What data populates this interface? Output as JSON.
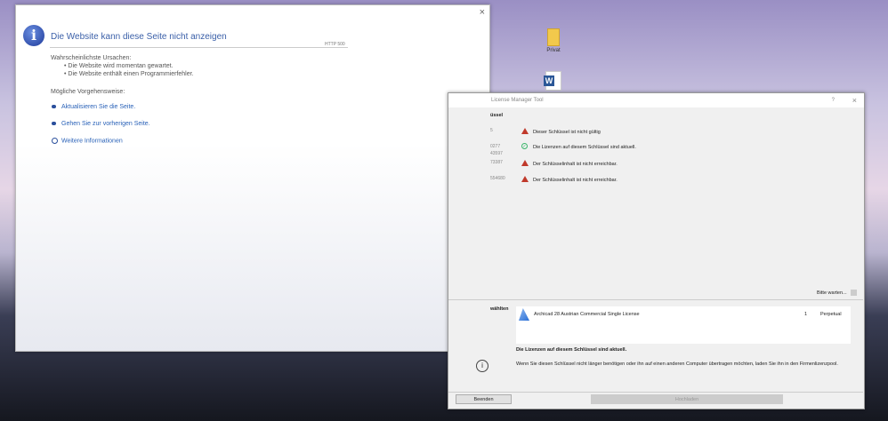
{
  "desktop": {
    "icons": [
      "Privat"
    ]
  },
  "ie_error": {
    "title": "Die Website kann diese Seite nicht anzeigen",
    "code": "HTTP 500",
    "causes_label": "Wahrscheinlichste Ursachen:",
    "causes": [
      "Die Website wird momentan gewartet.",
      "Die Website enthält einen Programmierfehler."
    ],
    "actions_label": "Mögliche Vorgehensweise:",
    "actions": [
      "Aktualisieren Sie die Seite.",
      "Gehen Sie zur vorherigen Seite."
    ],
    "more_info": "Weitere Informationen",
    "close": "×"
  },
  "license_manager": {
    "title": "License Manager Tool",
    "help": "?",
    "close": "×",
    "section": "üssel",
    "keys": [
      {
        "id": "5",
        "status": "Dieser Schlüssel ist nicht gültig",
        "type": "warning"
      },
      {
        "id": "0277\n43597",
        "status": "Die Lizenzen auf diesem Schlüssel sind aktuell.",
        "type": "ok"
      },
      {
        "id": "73387",
        "status": "Der Schlüsselinhalt ist nicht erreichbar.",
        "type": "warning"
      },
      {
        "id": "554680",
        "status": "Der Schlüsselinhalt ist nicht erreichbar.",
        "type": "warning"
      }
    ],
    "wait": "Bitte warten...",
    "selected_label": "wählten",
    "license": {
      "name": "Archicad 28 Austrian Commercial Single License",
      "count": "1",
      "type": "Perpetual"
    },
    "status_bold": "Die Lizenzen auf diesem Schlüssel sind aktuell.",
    "info_text": "Wenn Sie diesen Schlüssel nicht länger benötigen oder ihn auf einen anderen Computer übertragen möchten, laden Sie ihn in den Firmenlizenzpool.",
    "quit": "Beenden",
    "upload": "Hochladen"
  }
}
